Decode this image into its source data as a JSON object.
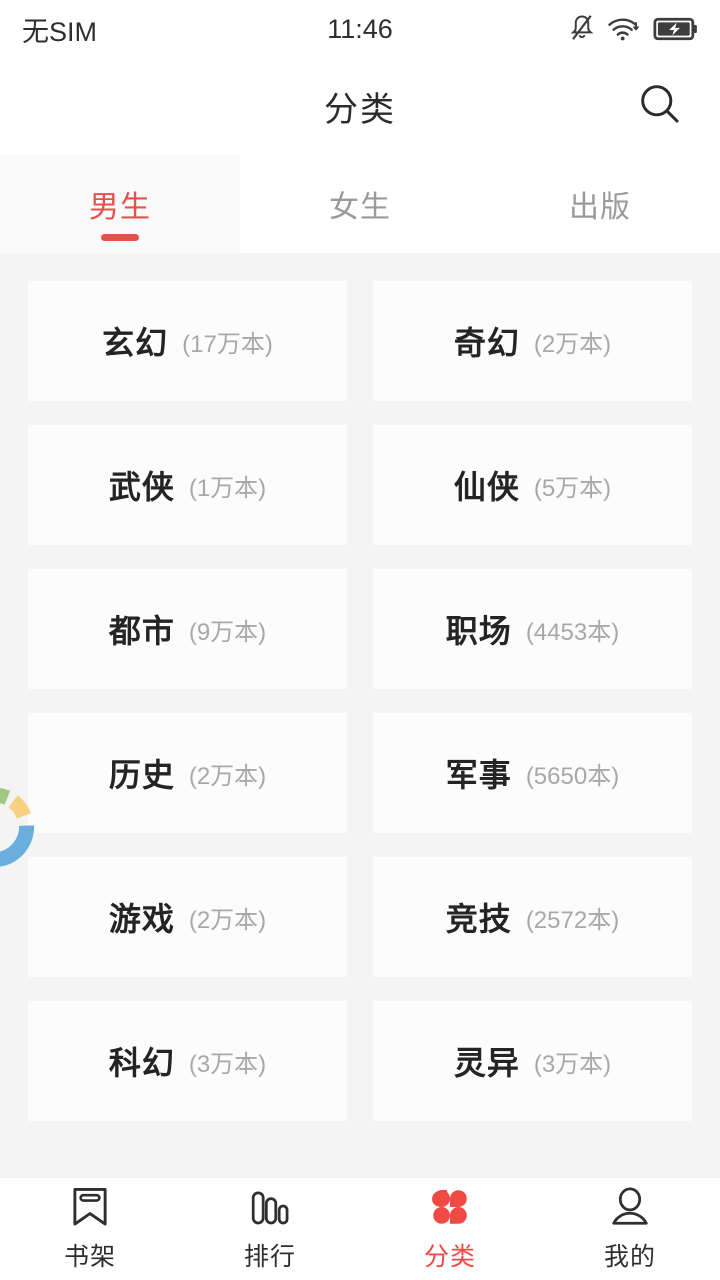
{
  "status_bar": {
    "carrier": "无SIM",
    "time": "11:46",
    "icons": [
      "bell-muted-icon",
      "wifi-icon",
      "battery-charging-icon"
    ]
  },
  "header": {
    "title": "分类",
    "search_icon": "search-icon"
  },
  "tabs": [
    {
      "label": "男生",
      "active": true
    },
    {
      "label": "女生",
      "active": false
    },
    {
      "label": "出版",
      "active": false
    }
  ],
  "categories": [
    {
      "name": "玄幻",
      "count": "(17万本)"
    },
    {
      "name": "奇幻",
      "count": "(2万本)"
    },
    {
      "name": "武侠",
      "count": "(1万本)"
    },
    {
      "name": "仙侠",
      "count": "(5万本)"
    },
    {
      "name": "都市",
      "count": "(9万本)"
    },
    {
      "name": "职场",
      "count": "(4453本)"
    },
    {
      "name": "历史",
      "count": "(2万本)"
    },
    {
      "name": "军事",
      "count": "(5650本)"
    },
    {
      "name": "游戏",
      "count": "(2万本)"
    },
    {
      "name": "竞技",
      "count": "(2572本)"
    },
    {
      "name": "科幻",
      "count": "(3万本)"
    },
    {
      "name": "灵异",
      "count": "(3万本)"
    }
  ],
  "floating_widget": {
    "name": "loading-donut-widget",
    "segment_colors": [
      "#dd6f91",
      "#9ec97f",
      "#f5d181",
      "#6aaedd"
    ]
  },
  "bottom_nav": [
    {
      "label": "书架",
      "icon": "bookmark-icon",
      "active": false
    },
    {
      "label": "排行",
      "icon": "ranking-bars-icon",
      "active": false
    },
    {
      "label": "分类",
      "icon": "category-dots-icon",
      "active": true
    },
    {
      "label": "我的",
      "icon": "person-icon",
      "active": false
    }
  ],
  "colors": {
    "accent": "#e5514a",
    "nav_active": "#f04a44",
    "page_bg": "#f4f4f4",
    "card_bg": "#fcfcfc",
    "text_primary": "#242424",
    "text_muted": "#a8a8a8"
  }
}
